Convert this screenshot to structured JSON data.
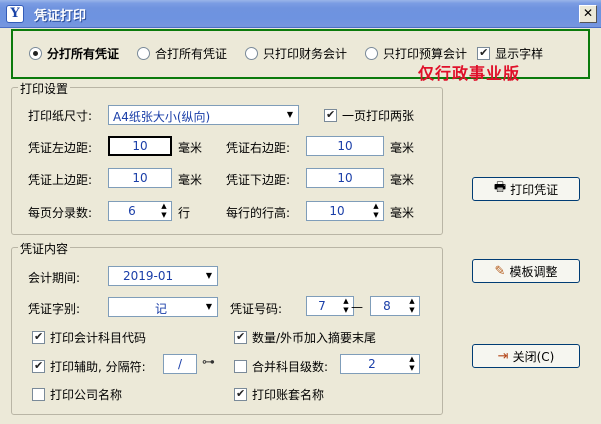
{
  "window": {
    "title": "凭证打印",
    "icon_letter": "Y",
    "close": "✕"
  },
  "print_scope": {
    "options": [
      {
        "label": "分打所有凭证",
        "selected": true
      },
      {
        "label": "合打所有凭证",
        "selected": false
      },
      {
        "label": "只打印财务会计",
        "selected": false
      },
      {
        "label": "只打印预算会计",
        "selected": false
      }
    ],
    "show_font_sample": {
      "label": "显示字样",
      "checked": true
    }
  },
  "edition": "仅行政事业版",
  "print_settings": {
    "legend": "打印设置",
    "paper_size_label": "打印纸尺寸:",
    "paper_size_value": "A4纸张大小(纵向)",
    "two_per_page": {
      "label": "一页打印两张",
      "checked": true
    },
    "left_margin_label": "凭证左边距:",
    "left_margin_value": "10",
    "right_margin_label": "凭证右边距:",
    "right_margin_value": "10",
    "top_margin_label": "凭证上边距:",
    "top_margin_value": "10",
    "bottom_margin_label": "凭证下边距:",
    "bottom_margin_value": "10",
    "unit_mm": "毫米",
    "entries_per_page_label": "每页分录数:",
    "entries_per_page_value": "6",
    "unit_row": "行",
    "row_height_label": "每行的行高:",
    "row_height_value": "10"
  },
  "voucher_content": {
    "legend": "凭证内容",
    "period_label": "会计期间:",
    "period_value": "2019-01",
    "word_label": "凭证字别:",
    "word_value": "记",
    "number_label": "凭证号码:",
    "number_from": "7",
    "number_sep": "—",
    "number_to": "8",
    "print_account_code": {
      "label": "打印会计科目代码",
      "checked": true
    },
    "qty_currency_to_summary": {
      "label": "数量/外币加入摘要末尾",
      "checked": true
    },
    "print_auxiliary": {
      "label": "打印辅助, 分隔符:",
      "checked": true
    },
    "separator_value": "/",
    "merge_levels": {
      "label": "合并科目级数:",
      "checked": false
    },
    "merge_levels_value": "2",
    "print_company_name": {
      "label": "打印公司名称",
      "checked": false
    },
    "print_book_name": {
      "label": "打印账套名称",
      "checked": true
    }
  },
  "buttons": {
    "print": "打印凭证",
    "template": "模板调整",
    "close": "关闭(C)"
  }
}
